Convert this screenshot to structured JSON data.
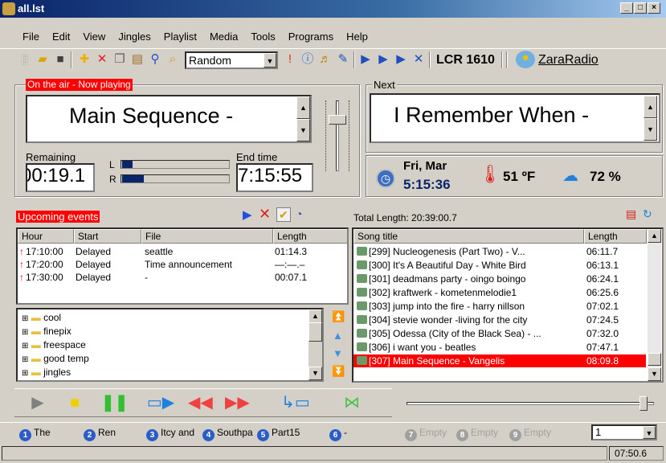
{
  "window": {
    "title": "all.lst"
  },
  "menu": [
    "File",
    "Edit",
    "View",
    "Jingles",
    "Playlist",
    "Media",
    "Tools",
    "Programs",
    "Help"
  ],
  "toolbar": {
    "mode_select": "Random",
    "station": "LCR 1610",
    "brand": "ZaraRadio"
  },
  "on_air": {
    "label": "On the air - Now playing",
    "title": "Main Sequence -",
    "remaining_label": "Remaining",
    "remaining": "00:19.1",
    "end_time_label": "End time",
    "end_time": "7:15:55",
    "meter_left_label": "L",
    "meter_right_label": "R",
    "meter_left_level": 0.1,
    "meter_right_level": 0.2
  },
  "next": {
    "label": "Next",
    "title": "I Remember When -"
  },
  "info": {
    "date": "Fri, Mar",
    "time": "5:15:36",
    "temperature": "51 ºF",
    "humidity": "72 %"
  },
  "events": {
    "label": "Upcoming events",
    "columns": [
      "Hour",
      "Start",
      "File",
      "Length"
    ],
    "rows": [
      {
        "hour": "17:10:00",
        "start": "Delayed",
        "file": "seattle",
        "length": "01:14.3"
      },
      {
        "hour": "17:20:00",
        "start": "Delayed",
        "file": "Time announcement",
        "length": "—:—.–"
      },
      {
        "hour": "17:30:00",
        "start": "Delayed",
        "file": "-",
        "length": "00:07.1"
      }
    ]
  },
  "folders": [
    "cool",
    "finepix",
    "freespace",
    "good temp",
    "jingles"
  ],
  "playlist": {
    "total_length": "Total Length: 20:39:00.7",
    "columns": [
      "Song title",
      "Length"
    ],
    "rows": [
      {
        "title": "[299] Nucleogenesis (Part Two)    - V...",
        "length": "06:11.7"
      },
      {
        "title": "[300] It's A Beautiful Day - White Bird",
        "length": "06:13.1"
      },
      {
        "title": "[301] deadmans party - oingo boingo",
        "length": "06:24.1"
      },
      {
        "title": "[302] kraftwerk - kometenmelodie1",
        "length": "06:25.6"
      },
      {
        "title": "[303] jump into the fire - harry nillson",
        "length": "07:02.1"
      },
      {
        "title": "[304] stevie wonder -living for the city",
        "length": "07:24.5"
      },
      {
        "title": "[305] Odessa (City of the Black Sea) - ...",
        "length": "07:32.0"
      },
      {
        "title": "[306] i want you - beatles",
        "length": "07:47.1"
      },
      {
        "title": "[307] Main Sequence - Vangelis",
        "length": "08:09.8"
      }
    ],
    "selected_index": 8
  },
  "carts": [
    {
      "num": "1",
      "label": "The"
    },
    {
      "num": "2",
      "label": "Ren"
    },
    {
      "num": "3",
      "label": "Itcy and"
    },
    {
      "num": "4",
      "label": "Southpa"
    },
    {
      "num": "5",
      "label": "Part15"
    },
    {
      "num": "6",
      "label": "-"
    },
    {
      "num": "7",
      "label": "Empty"
    },
    {
      "num": "8",
      "label": "Empty"
    },
    {
      "num": "9",
      "label": "Empty"
    }
  ],
  "cart_page": "1",
  "status": {
    "time": "07:50.6"
  },
  "colors": {
    "accent_red": "#ff0000",
    "title_blue": "#0a246a"
  }
}
